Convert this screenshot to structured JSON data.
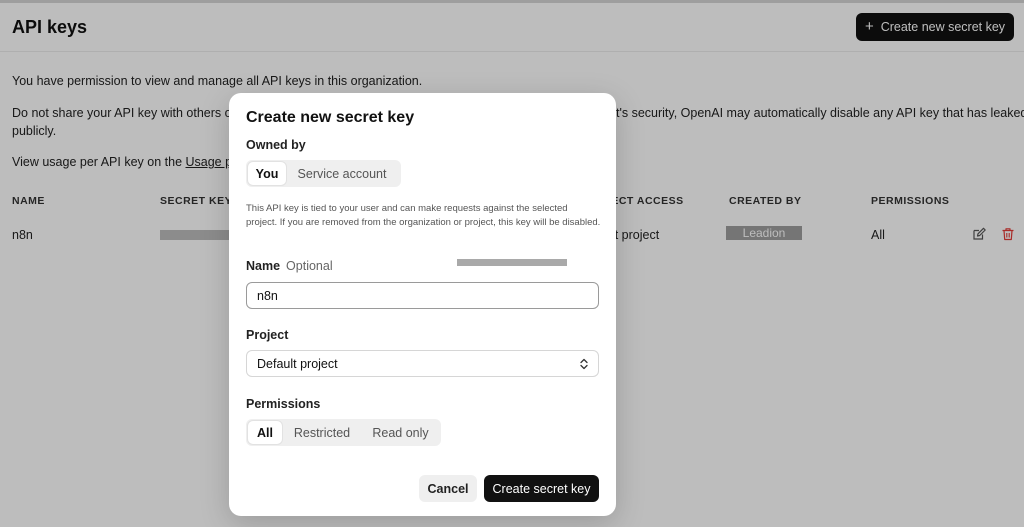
{
  "page": {
    "title": "API keys",
    "create_button_label": "Create new secret key",
    "paragraph1": "You have permission to view and manage all API keys in this organization.",
    "paragraph2_left": "Do not share your API key with others or",
    "paragraph2_right": "t's security, OpenAI may automatically disable any API key that has leaked",
    "paragraph2_line2": "publicly.",
    "paragraph3_prefix": "View usage per API key on the ",
    "paragraph3_link": "Usage pag"
  },
  "table": {
    "headers": {
      "name": "NAME",
      "secret_key": "SECRET KEY",
      "project_access": "JECT ACCESS",
      "created_by": "CREATED BY",
      "permissions": "PERMISSIONS"
    },
    "rows": [
      {
        "name": "n8n",
        "project_access": "ult project",
        "created_by": "Leadion",
        "permissions": "All"
      }
    ]
  },
  "modal": {
    "title": "Create new secret key",
    "owned_by_label": "Owned by",
    "owner_options": [
      "You",
      "Service account"
    ],
    "owner_selected": "You",
    "help_text": "This API key is tied to your user and can make requests against the selected project. If you are removed from the organization or project, this key will be disabled.",
    "name_label": "Name",
    "name_optional": "Optional",
    "name_value": "n8n",
    "project_label": "Project",
    "project_value": "Default project",
    "permissions_label": "Permissions",
    "permission_options": [
      "All",
      "Restricted",
      "Read only"
    ],
    "permission_selected": "All",
    "cancel_label": "Cancel",
    "submit_label": "Create secret key"
  },
  "icons": {
    "create_button": "plus-icon",
    "row_edit": "pencil-icon",
    "row_delete": "trash-icon",
    "project_select": "chevron-up-down-icon"
  },
  "colors": {
    "primary_button": "#111111",
    "delete_icon": "#e53935",
    "overlay": "rgba(0,0,0,0.26)"
  }
}
